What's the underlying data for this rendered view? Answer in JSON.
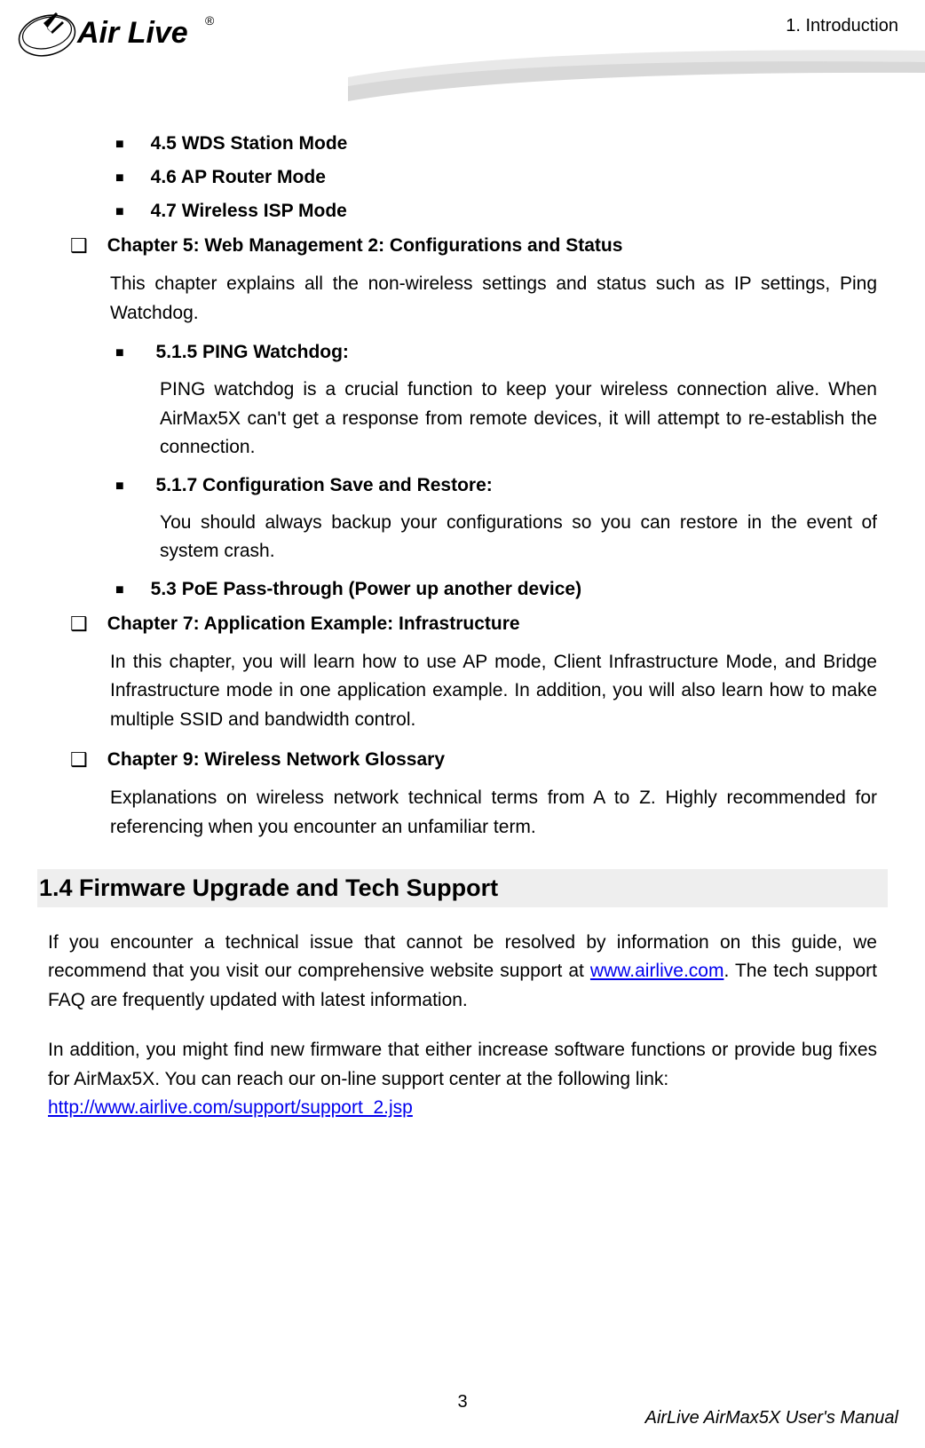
{
  "header": {
    "brand_line1": "Air",
    "brand_line2": "Live",
    "section_label": "1. Introduction",
    "registered": "®"
  },
  "bullets": {
    "b_4_5": "4.5 WDS Station Mode",
    "b_4_6": "4.6 AP Router Mode",
    "b_4_7": "4.7 Wireless ISP Mode",
    "ch5_title": "Chapter 5: Web Management 2: Configurations and Status",
    "ch5_desc": "This chapter explains all the non-wireless settings and status such as IP settings, Ping Watchdog.",
    "b_5_1_5_title": "5.1.5 PING Watchdog:",
    "b_5_1_5_desc": "PING watchdog is a crucial function to keep your wireless connection alive. When AirMax5X can't get a response from remote devices, it will attempt to re-establish the connection.",
    "b_5_1_7_title": "5.1.7 Configuration Save and Restore:",
    "b_5_1_7_desc": "You should always backup your configurations so you can restore in the event of system crash.",
    "b_5_3": "5.3 PoE Pass-through (Power up another device)",
    "ch7_title": "Chapter 7: Application Example: Infrastructure",
    "ch7_desc": "In this chapter, you will learn how to use AP mode, Client Infrastructure Mode, and Bridge Infrastructure mode in one application example. In addition, you will also learn how to make multiple SSID and bandwidth control.",
    "ch9_title": "Chapter 9: Wireless Network Glossary",
    "ch9_desc": "Explanations on wireless network technical terms from A to Z. Highly recommended for referencing when you encounter an unfamiliar term."
  },
  "section_1_4": {
    "heading": "1.4 Firmware Upgrade and Tech Support",
    "p1_pre": "If you encounter a technical issue that cannot be resolved by information on this guide, we recommend that you visit our comprehensive website support at ",
    "p1_link": "www.airlive.com",
    "p1_post": ". The tech support FAQ are frequently updated with latest information.",
    "p2": "In addition, you might find new firmware that either increase software functions or provide bug fixes for AirMax5X. You can reach our on-line support center at the following link:",
    "p2_link": "http://www.airlive.com/support/support_2.jsp"
  },
  "footer": {
    "page_number": "3",
    "manual_title": "AirLive AirMax5X User's Manual"
  }
}
